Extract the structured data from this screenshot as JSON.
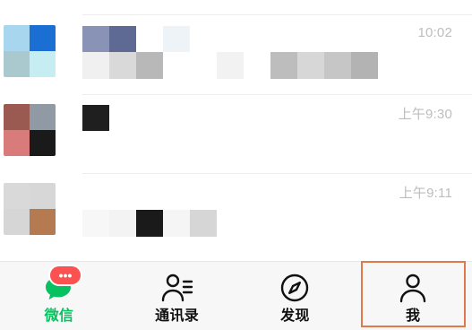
{
  "chat_list": {
    "rows": [
      {
        "time": "",
        "avatar_tiles": [
          "#ffffff",
          "#ffffff",
          "#ffffff",
          "#ffffff"
        ],
        "name_blocks": [],
        "message_blocks": []
      },
      {
        "time": "10:02",
        "avatar_tiles": [
          "#a8d6ee",
          "#1b6fd3",
          "#a9c9cf",
          "#c6eef2"
        ],
        "name_blocks": [
          "#8893b5",
          "#5e6a94",
          "#ffffff",
          "#eef3f8"
        ],
        "message_blocks": [
          "#f0f0f0",
          "#d9d9d9",
          "#b8b8b8",
          "#ffffff",
          "#ffffff",
          "#f2f2f2",
          "#ffffff",
          "#bdbdbd",
          "#d7d7d7",
          "#c6c6c6",
          "#b3b3b3"
        ]
      },
      {
        "time": "上午9:30",
        "avatar_tiles": [
          "#9a5a52",
          "#8f9aa4",
          "#d97b7b",
          "#1a1a1a"
        ],
        "name_blocks": [
          "#1f1f1f"
        ],
        "message_blocks": []
      },
      {
        "time": "上午9:11",
        "avatar_tiles": [
          "#d9d9d9",
          "#d7d7d7",
          "#d6d6d6",
          "#b57a4f"
        ],
        "name_blocks": [],
        "message_blocks": [
          "#f7f7f7",
          "#f3f3f3",
          "#1a1a1a",
          "#f5f5f5",
          "#d6d6d6"
        ]
      }
    ]
  },
  "tabbar": {
    "tabs": [
      {
        "label": "微信",
        "icon": "chat-bubble-icon",
        "active": true
      },
      {
        "label": "通讯录",
        "icon": "contacts-icon",
        "active": false
      },
      {
        "label": "发现",
        "icon": "compass-icon",
        "active": false
      },
      {
        "label": "我",
        "icon": "person-icon",
        "active": false
      }
    ],
    "badge": "•••"
  },
  "colors": {
    "accent_green": "#07c160",
    "badge_red": "#fa5151",
    "highlight_orange": "#e0794e"
  }
}
